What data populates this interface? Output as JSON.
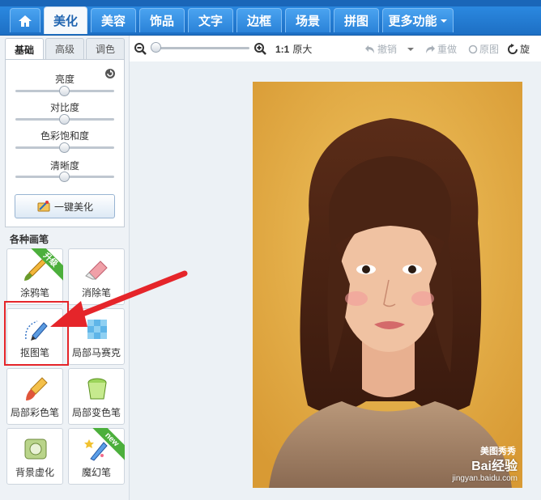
{
  "nav_tabs": [
    {
      "label": "美化",
      "active": true
    },
    {
      "label": "美容"
    },
    {
      "label": "饰品"
    },
    {
      "label": "文字"
    },
    {
      "label": "边框"
    },
    {
      "label": "场景"
    },
    {
      "label": "拼图"
    },
    {
      "label": "更多功能"
    }
  ],
  "sub_tabs": [
    {
      "label": "基础",
      "active": true
    },
    {
      "label": "高级"
    },
    {
      "label": "调色"
    }
  ],
  "sliders": [
    {
      "label": "亮度",
      "value": 0.5
    },
    {
      "label": "对比度",
      "value": 0.5
    },
    {
      "label": "色彩饱和度",
      "value": 0.5
    },
    {
      "label": "清晰度",
      "value": 0.5
    }
  ],
  "auto_button": "一键美化",
  "brush_section_title": "各种画笔",
  "brushes": [
    {
      "label": "涂鸦笔",
      "icon": "paintbrush-icon",
      "badge": "升级"
    },
    {
      "label": "消除笔",
      "icon": "eraser-icon"
    },
    {
      "label": "抠图笔",
      "icon": "cutout-pen-icon",
      "highlighted": true
    },
    {
      "label": "局部马赛克",
      "icon": "mosaic-icon"
    },
    {
      "label": "局部彩色笔",
      "icon": "color-brush-icon"
    },
    {
      "label": "局部变色笔",
      "icon": "recolor-bucket-icon"
    },
    {
      "label": "背景虚化",
      "icon": "blur-background-icon"
    },
    {
      "label": "魔幻笔",
      "icon": "magic-pen-icon",
      "badge": "new"
    }
  ],
  "toolbar": {
    "zoom_level": 0,
    "ratio_label": "1:1",
    "original_size": "原大",
    "undo": "撤销",
    "redo": "重做",
    "original": "原图",
    "rotate": "旋"
  },
  "watermark": {
    "main": "Bai经验",
    "sub": "jingyan.baidu.com",
    "credit": "美图秀秀"
  },
  "colors": {
    "accent": "#1f6fc5",
    "highlight_red": "#e5252a",
    "badge_green": "#4caf3c"
  }
}
